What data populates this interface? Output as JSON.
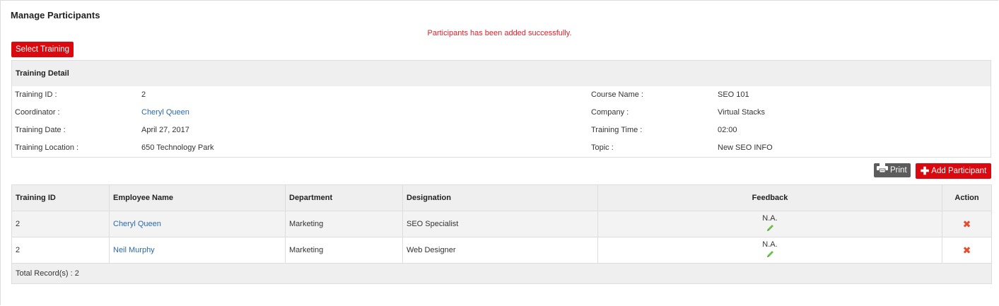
{
  "page": {
    "title": "Manage Participants",
    "success_message": "Participants has been added successfully.",
    "select_training_label": "Select Training"
  },
  "detail": {
    "header": "Training Detail",
    "left": [
      {
        "label": "Training ID :",
        "value": "2"
      },
      {
        "label": "Coordinator :",
        "value": "Cheryl Queen"
      },
      {
        "label": "Training Date :",
        "value": "April 27, 2017"
      },
      {
        "label": "Training Location :",
        "value": "650 Technology Park"
      }
    ],
    "right": [
      {
        "label": "Course Name :",
        "value": "SEO 101"
      },
      {
        "label": "Company :",
        "value": "Virtual Stacks"
      },
      {
        "label": "Training Time :",
        "value": "02:00"
      },
      {
        "label": "Topic :",
        "value": "New SEO INFO"
      }
    ]
  },
  "toolbar": {
    "print_label": "Print",
    "add_label": "Add Participant",
    "print_icon": "printer-icon",
    "add_icon": "plus-icon"
  },
  "table": {
    "headers": [
      "Training ID",
      "Employee Name",
      "Department",
      "Designation",
      "Feedback",
      "Action"
    ],
    "rows": [
      {
        "training_id": "2",
        "employee": "Cheryl Queen",
        "department": "Marketing",
        "designation": "SEO Specialist",
        "feedback": "N.A."
      },
      {
        "training_id": "2",
        "employee": "Neil Murphy",
        "department": "Marketing",
        "designation": "Web Designer",
        "feedback": "N.A."
      }
    ],
    "footer": "Total Record(s) :  2"
  },
  "colors": {
    "accent_red": "#d9090f",
    "message_red": "#d9232d",
    "link_blue": "#2a6aa8",
    "header_gray": "#efefef",
    "print_gray": "#5c5c5c",
    "pencil_green": "#6cbf4e",
    "remove_red": "#e64c2e"
  }
}
